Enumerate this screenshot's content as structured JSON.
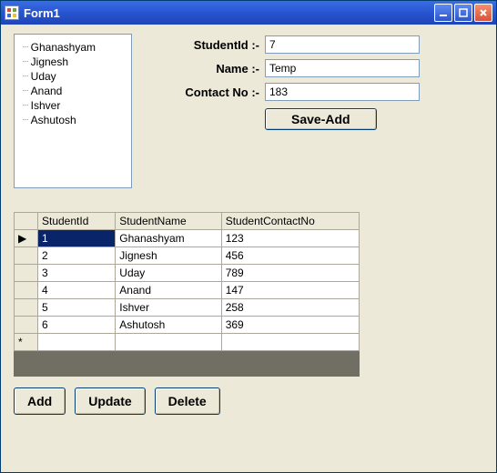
{
  "window": {
    "title": "Form1"
  },
  "tree": {
    "items": [
      "Ghanashyam",
      "Jignesh",
      "Uday",
      "Anand",
      "Ishver",
      "Ashutosh"
    ]
  },
  "form": {
    "studentId": {
      "label": "StudentId :-",
      "value": "7"
    },
    "name": {
      "label": "Name :-",
      "value": "Temp"
    },
    "contactNo": {
      "label": "Contact No :-",
      "value": "183"
    },
    "saveAdd": "Save-Add"
  },
  "grid": {
    "columns": [
      "StudentId",
      "StudentName",
      "StudentContactNo"
    ],
    "rows": [
      {
        "id": "1",
        "name": "Ghanashyam",
        "contact": "123",
        "currentRow": true,
        "selectedCell": 0
      },
      {
        "id": "2",
        "name": "Jignesh",
        "contact": "456"
      },
      {
        "id": "3",
        "name": "Uday",
        "contact": "789"
      },
      {
        "id": "4",
        "name": "Anand",
        "contact": "147"
      },
      {
        "id": "5",
        "name": "Ishver",
        "contact": "258"
      },
      {
        "id": "6",
        "name": "Ashutosh",
        "contact": "369"
      }
    ],
    "rowIndicator": "▶",
    "newRowIndicator": "*"
  },
  "buttons": {
    "add": "Add",
    "update": "Update",
    "delete": "Delete"
  }
}
